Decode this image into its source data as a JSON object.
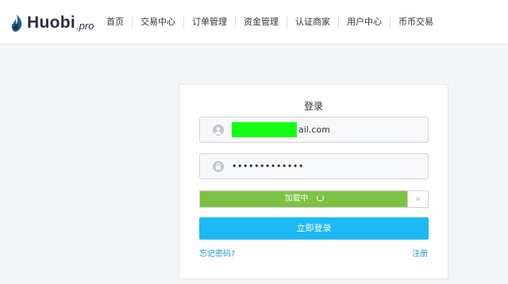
{
  "brand": {
    "name": "Huobi",
    "suffix": ".pro",
    "accent": "#2b3041"
  },
  "nav": {
    "items": [
      "首页",
      "交易中心",
      "订单管理",
      "资金管理",
      "认证商家",
      "用户中心",
      "币币交易"
    ]
  },
  "login": {
    "title": "登录",
    "email_visible_tail": "ail.com",
    "password_mask": "•••••••••••••",
    "slider_status": "加载中",
    "slider_progress": 0.91,
    "slider_handle": "»",
    "submit_label": "立即登录",
    "forgot_label": "忘记密码?",
    "register_label": "注册"
  },
  "colors": {
    "primary_button": "#1cb9f4",
    "slider_fill": "#7dc242",
    "link": "#1a9cd8",
    "redaction": "#15ff15"
  },
  "icons": {
    "logo": "huobi-flame-icon",
    "email_field": "user-icon",
    "password_field": "lock-icon",
    "slider_handle": "double-chevron-right-icon",
    "slider_status": "spinner-icon"
  }
}
